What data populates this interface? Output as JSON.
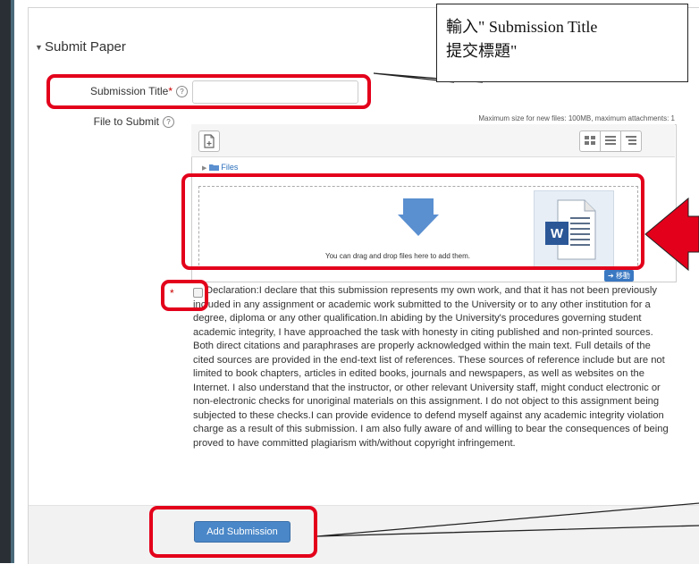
{
  "section": {
    "title": "Submit Paper",
    "toggle_icon": "triangle-down-icon"
  },
  "form": {
    "submission_title": {
      "label": "Submission Title",
      "required_mark": "*",
      "help_glyph": "?",
      "value": ""
    },
    "file_to_submit": {
      "label": "File to Submit",
      "help_glyph": "?"
    },
    "max_size_text": "Maximum size for new files: 100MB, maximum attachments: 1"
  },
  "filemanager": {
    "path_label": "Files",
    "drop_text": "You can drag and drop files here to add them.",
    "move_label": "移動",
    "view_icons": [
      "icons-view-icon",
      "list-view-icon",
      "tree-view-icon"
    ]
  },
  "declaration": {
    "required_mark": "*",
    "text": "Declaration:I declare that this submission represents my own work, and that it has not been previously included in any assignment or academic work submitted to the University or to any other institution for a degree, diploma or any other qualification.In abiding by the University's procedures governing student academic integrity, I have approached the task with honesty in citing published and non-printed sources. Both direct citations and paraphrases are properly acknowledged within the main text. Full details of the cited sources are provided in the end-text list of references. These sources of reference include but are not limited to book chapters, articles in edited books, journals and newspapers, as well as websites on the Internet. I also understand that the instructor, or other relevant University staff, might conduct electronic or non-electronic checks for unoriginal materials on this assignment. I do not object to this assignment being subjected to these checks.I can provide evidence to defend myself against any academic integrity violation charge as a result of this submission. I am also fully aware of and willing to bear the consequences of being proved to have committed plagiarism with/without copyright infringement."
  },
  "footer": {
    "submit_label": "Add Submission"
  },
  "annotation": {
    "callout_line1": "輸入\" Submission Title",
    "callout_line2": "提交標題\"",
    "word_badge": "W"
  },
  "colors": {
    "annotation_red": "#e3001b",
    "primary_button": "#4a87c8",
    "link_blue": "#2a6ebb"
  }
}
